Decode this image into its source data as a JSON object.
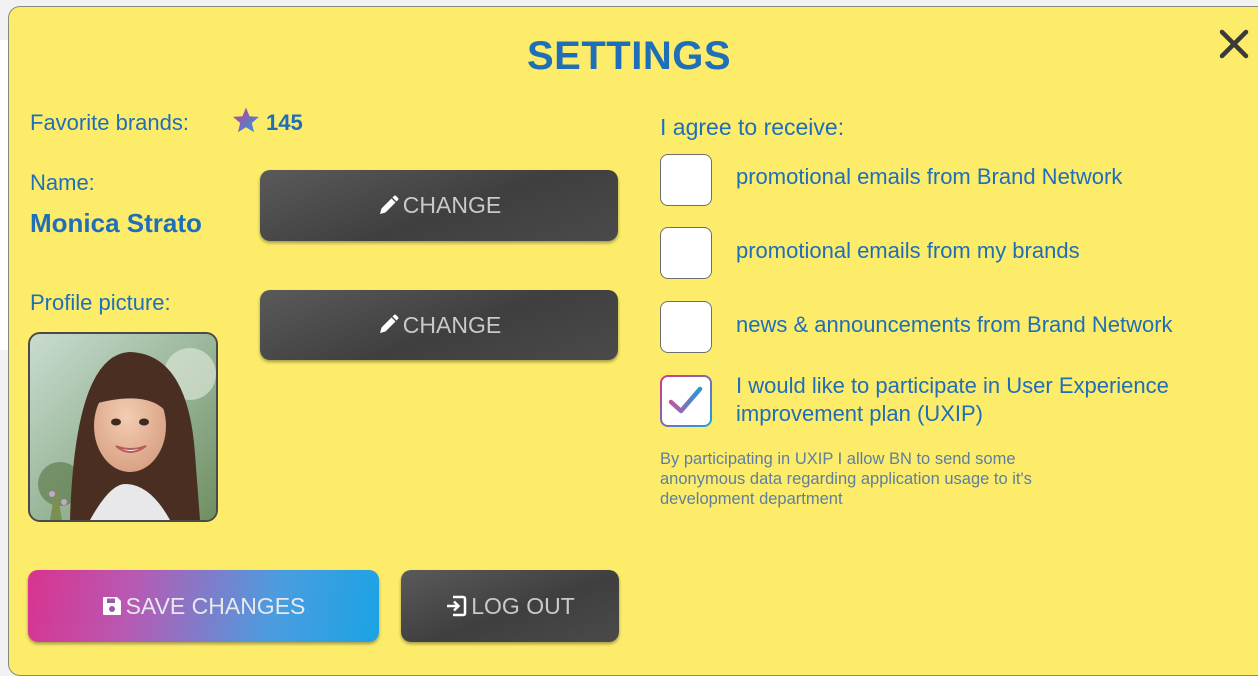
{
  "dialog": {
    "title": "SETTINGS",
    "close_icon": "close-x-icon"
  },
  "profile": {
    "favorite_brands_label": "Favorite brands:",
    "favorite_brands_icon": "star-icon",
    "favorite_brands_count": "145",
    "name_label": "Name:",
    "name_value": "Monica Strato",
    "change_name_label": "CHANGE",
    "profile_picture_label": "Profile picture:",
    "change_picture_label": "CHANGE",
    "edit_icon": "pencil-icon"
  },
  "actions": {
    "save_label": "SAVE CHANGES",
    "save_icon": "floppy-disk-icon",
    "logout_label": "LOG OUT",
    "logout_icon": "sign-out-icon"
  },
  "consent": {
    "heading": "I agree to receive:",
    "options": [
      {
        "label": "promotional emails from Brand Network",
        "checked": false
      },
      {
        "label": "promotional emails from my brands",
        "checked": false
      },
      {
        "label": "news & announcements from Brand Network",
        "checked": false
      },
      {
        "label": "I would like to participate in User Experience improvement plan (UXIP)",
        "checked": true
      }
    ],
    "uxip_note": "By participating in UXIP I allow BN to send some anonymous data regarding application usage to it's development department"
  },
  "colors": {
    "dialog_bg": "#fdec6a",
    "accent_blue": "#1e6fb8",
    "button_dark": "#4a4a4a",
    "gradient_pink": "#d8338f",
    "gradient_blue": "#1aa3e4"
  }
}
